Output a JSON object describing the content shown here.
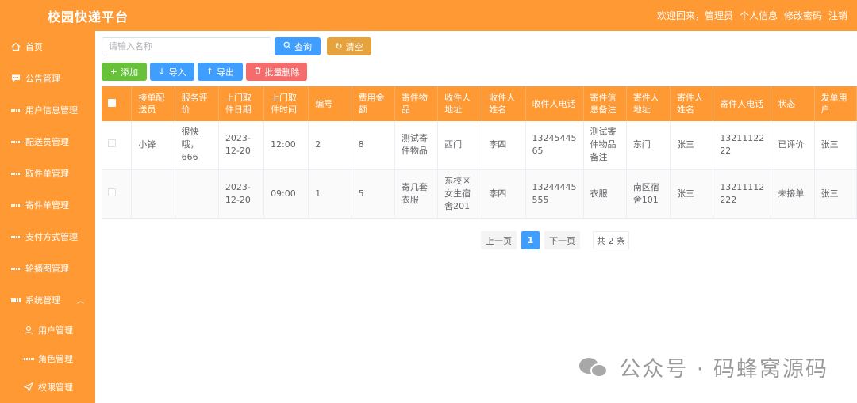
{
  "header": {
    "brand": "校园快递平台",
    "welcome": "欢迎回来，管理员",
    "profile": "个人信息",
    "change_password": "修改密码",
    "logout": "注销"
  },
  "sidebar": {
    "items": [
      {
        "label": "首页",
        "icon": "home-icon"
      },
      {
        "label": "公告管理",
        "icon": "chat-icon"
      },
      {
        "label": "用户信息管理",
        "icon": "grid-icon"
      },
      {
        "label": "配送员管理",
        "icon": "grid-icon"
      },
      {
        "label": "取件单管理",
        "icon": "grid-icon"
      },
      {
        "label": "寄件单管理",
        "icon": "grid-icon"
      },
      {
        "label": "支付方式管理",
        "icon": "grid-icon"
      },
      {
        "label": "轮播图管理",
        "icon": "grid-icon"
      },
      {
        "label": "系统管理",
        "icon": "menu-icon"
      }
    ],
    "sub_items": [
      {
        "label": "用户管理",
        "icon": "user-icon"
      },
      {
        "label": "角色管理",
        "icon": "grid-icon"
      },
      {
        "label": "权限管理",
        "icon": "send-icon"
      }
    ]
  },
  "search": {
    "placeholder": "请输入名称",
    "query_label": "查询",
    "clear_label": "清空"
  },
  "actions": {
    "add": "添加",
    "import": "导入",
    "export": "导出",
    "batch_delete": "批量删除"
  },
  "table": {
    "headers": [
      "接单配送员",
      "服务评价",
      "上门取件日期",
      "上门取件时间",
      "编号",
      "费用金额",
      "寄件物品",
      "收件人地址",
      "收件人姓名",
      "收件人电话",
      "寄件信息备注",
      "寄件人地址",
      "寄件人姓名",
      "寄件人电话",
      "状态",
      "发单用户"
    ],
    "rows": [
      [
        "小锋",
        "很快哦，666",
        "2023-12-20",
        "12:00",
        "2",
        "8",
        "测试寄件物品",
        "西门",
        "李四",
        "13245445 65",
        "测试寄件物品备注",
        "东门",
        "张三",
        "13211122 22",
        "已评价",
        "张三"
      ],
      [
        "",
        "",
        "2023-12-20",
        "09:00",
        "1",
        "5",
        "寄几套衣服",
        "东校区女生宿舍201",
        "李四",
        "13244445 555",
        "衣服",
        "南区宿舍101",
        "张三",
        "13211112 222",
        "未接单",
        "张三"
      ]
    ]
  },
  "pagination": {
    "prev": "上一页",
    "current": "1",
    "next": "下一页",
    "total": "共 2 条"
  },
  "watermark": "公众号 · 码蜂窝源码",
  "colors": {
    "primary": "#ff9933",
    "blue": "#409eff",
    "green": "#67c23a",
    "orange_btn": "#e6a23c",
    "red": "#f56c6c"
  }
}
